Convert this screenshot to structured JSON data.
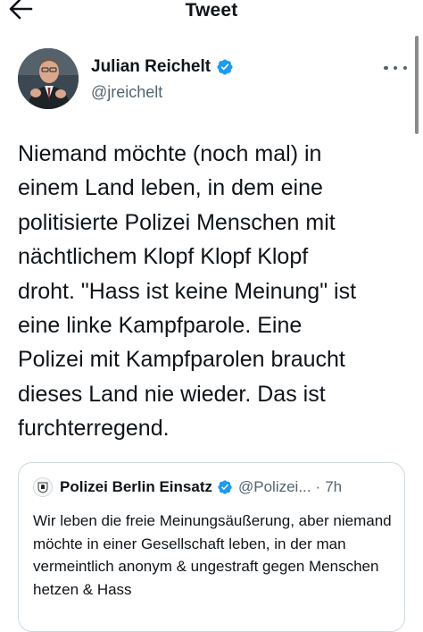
{
  "header": {
    "title": "Tweet",
    "back_icon": "arrow-left-icon"
  },
  "author": {
    "name": "Julian Reichelt",
    "handle": "@jreichelt",
    "verified": true,
    "avatar_icon": "avatar-photo",
    "more_icon": "more-horizontal-icon"
  },
  "tweet": {
    "text": "Niemand möchte (noch mal) in\neinem Land leben, in dem eine\npolitisierte Polizei Menschen mit\nnächtlichem Klopf Klopf Klopf\ndroht. \"Hass ist keine Meinung\" ist\neine linke Kampfparole. Eine\nPolizei mit Kampfparolen braucht\ndieses Land nie wieder. Das ist\nfurchterregend."
  },
  "quote": {
    "name": "Polizei Berlin Einsatz",
    "handle": "@Polizei...",
    "separator": "·",
    "time": "7h",
    "verified": true,
    "avatar_icon": "police-badge-icon",
    "text": "Wir leben die freie Meinungsäußerung, aber niemand möchte in einer Gesellschaft leben, in der man vermeintlich anonym & ungestraft gegen Menschen hetzen & Hass"
  },
  "colors": {
    "verified": "#1d9bf0",
    "text": "#0f1419",
    "secondary": "#536471",
    "border": "#cfd9de"
  }
}
